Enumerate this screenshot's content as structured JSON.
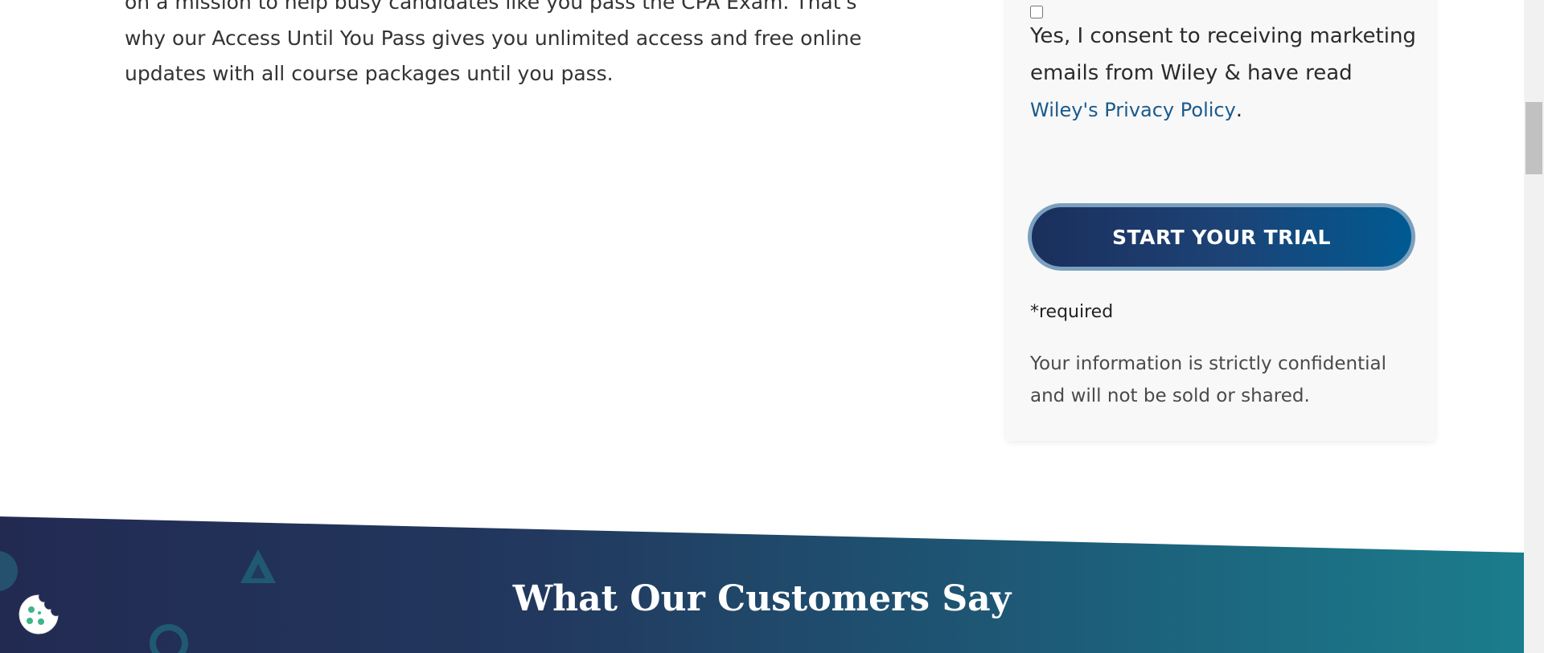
{
  "intro": {
    "line1": "on a mission to help busy candidates like you pass the CPA Exam. That's",
    "line2": "why our Access Until You Pass gives you unlimited access and free online",
    "line3": "updates with all course packages until you pass."
  },
  "form": {
    "consent_text": "Yes, I consent to receiving marketing emails from Wiley & have read ",
    "privacy_link": "Wiley's Privacy Policy",
    "consent_period": ".",
    "submit_label": "START YOUR TRIAL",
    "required_note": "*required",
    "privacy_note": "Your information is strictly confidential and will not be sold or shared."
  },
  "testimonials": {
    "title": "What Our Customers Say"
  },
  "icons": {
    "cookie": "cookie-icon",
    "triangle": "triangle-decoration-icon",
    "ring": "ring-decoration-icon"
  },
  "colors": {
    "button_start": "#1a2f5c",
    "button_end": "#005a92",
    "link": "#1a5a8c",
    "band_start": "#222a52",
    "band_end": "#1b7d8c"
  }
}
